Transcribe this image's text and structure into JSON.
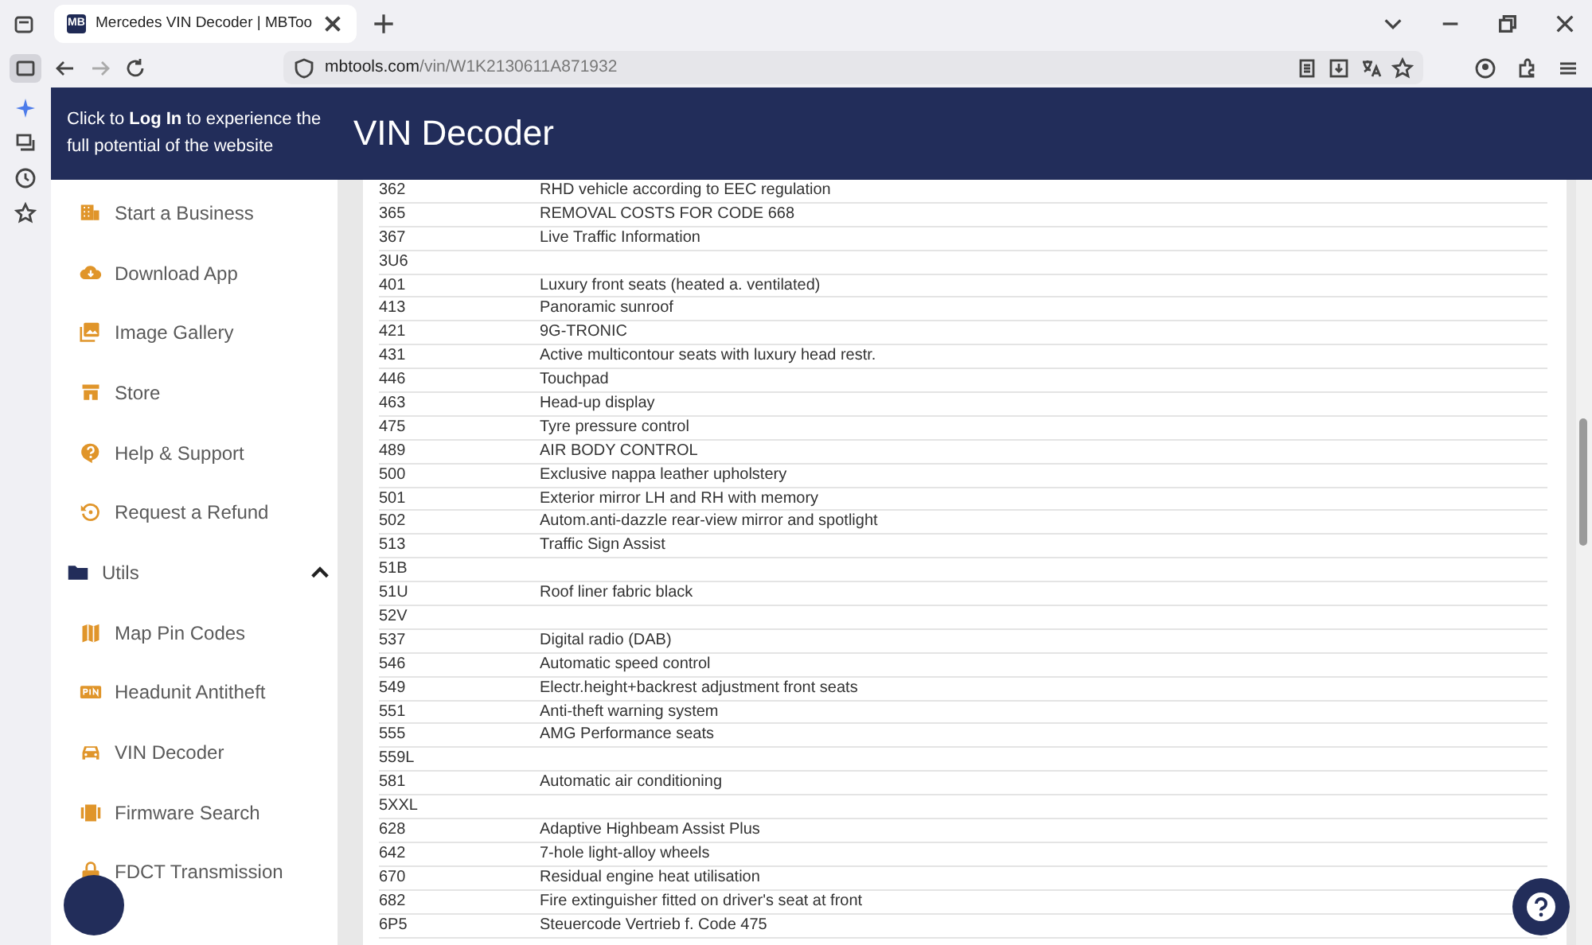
{
  "browser": {
    "tabs": [
      {
        "favicon": "MB",
        "title": "Mercedes VIN Decoder | MBToo",
        "selected": true
      }
    ],
    "address": {
      "domain": "mbtools.com",
      "path": "/vin/W1K2130611A871932"
    }
  },
  "login_banner": "Click to **Log In** to experience the full potential of the website",
  "page_title": "VIN Decoder",
  "nav": {
    "items": [
      {
        "kind": "link",
        "label": "Start a Business"
      },
      {
        "kind": "link",
        "label": "Download App"
      },
      {
        "kind": "link",
        "label": "Image Gallery"
      },
      {
        "kind": "link",
        "label": "Store"
      },
      {
        "kind": "link",
        "label": "Help & Support"
      },
      {
        "kind": "link",
        "label": "Request a Refund"
      },
      {
        "kind": "group",
        "label": "Utils",
        "expanded": true,
        "children": [
          {
            "kind": "link",
            "label": "Map Pin Codes"
          },
          {
            "kind": "link",
            "label": "Headunit Antitheft"
          },
          {
            "kind": "link",
            "label": "VIN Decoder"
          },
          {
            "kind": "link",
            "label": "Firmware Search"
          },
          {
            "kind": "link",
            "label": "FDCT Transmission"
          }
        ]
      }
    ]
  },
  "table": {
    "rows": [
      {
        "code": "362",
        "description": "RHD vehicle according to EEC regulation"
      },
      {
        "code": "365",
        "description": "REMOVAL COSTS FOR CODE 668"
      },
      {
        "code": "367",
        "description": "Live Traffic Information"
      },
      {
        "code": "3U6"
      },
      {
        "code": "401",
        "description": "Luxury front seats (heated a. ventilated)"
      },
      {
        "code": "413",
        "description": "Panoramic sunroof"
      },
      {
        "code": "421",
        "description": "9G-TRONIC"
      },
      {
        "code": "431",
        "description": "Active multicontour seats with luxury head restr."
      },
      {
        "code": "446",
        "description": "Touchpad"
      },
      {
        "code": "463",
        "description": "Head-up display"
      },
      {
        "code": "475",
        "description": "Tyre pressure control"
      },
      {
        "code": "489",
        "description": "AIR BODY CONTROL"
      },
      {
        "code": "500",
        "description": "Exclusive nappa leather upholstery"
      },
      {
        "code": "501",
        "description": "Exterior mirror LH and RH with memory"
      },
      {
        "code": "502",
        "description": "Autom.anti-dazzle rear-view mirror and spotlight"
      },
      {
        "code": "513",
        "description": "Traffic Sign Assist"
      },
      {
        "code": "51B"
      },
      {
        "code": "51U",
        "description": "Roof liner fabric black"
      },
      {
        "code": "52V"
      },
      {
        "code": "537",
        "description": "Digital radio (DAB)"
      },
      {
        "code": "546",
        "description": "Automatic speed control"
      },
      {
        "code": "549",
        "description": "Electr.height+backrest adjustment front seats"
      },
      {
        "code": "551",
        "description": "Anti-theft warning system"
      },
      {
        "code": "555",
        "description": "AMG Performance seats"
      },
      {
        "code": "559L"
      },
      {
        "code": "581",
        "description": "Automatic air conditioning"
      },
      {
        "code": "5XXL"
      },
      {
        "code": "628",
        "description": "Adaptive Highbeam Assist Plus"
      },
      {
        "code": "642",
        "description": "7-hole light-alloy wheels"
      },
      {
        "code": "670",
        "description": "Residual engine heat utilisation"
      },
      {
        "code": "682",
        "description": "Fire extinguisher fitted on driver's seat at front"
      },
      {
        "code": "6P5",
        "description": "Steuercode Vertrieb f. Code 475"
      }
    ]
  }
}
